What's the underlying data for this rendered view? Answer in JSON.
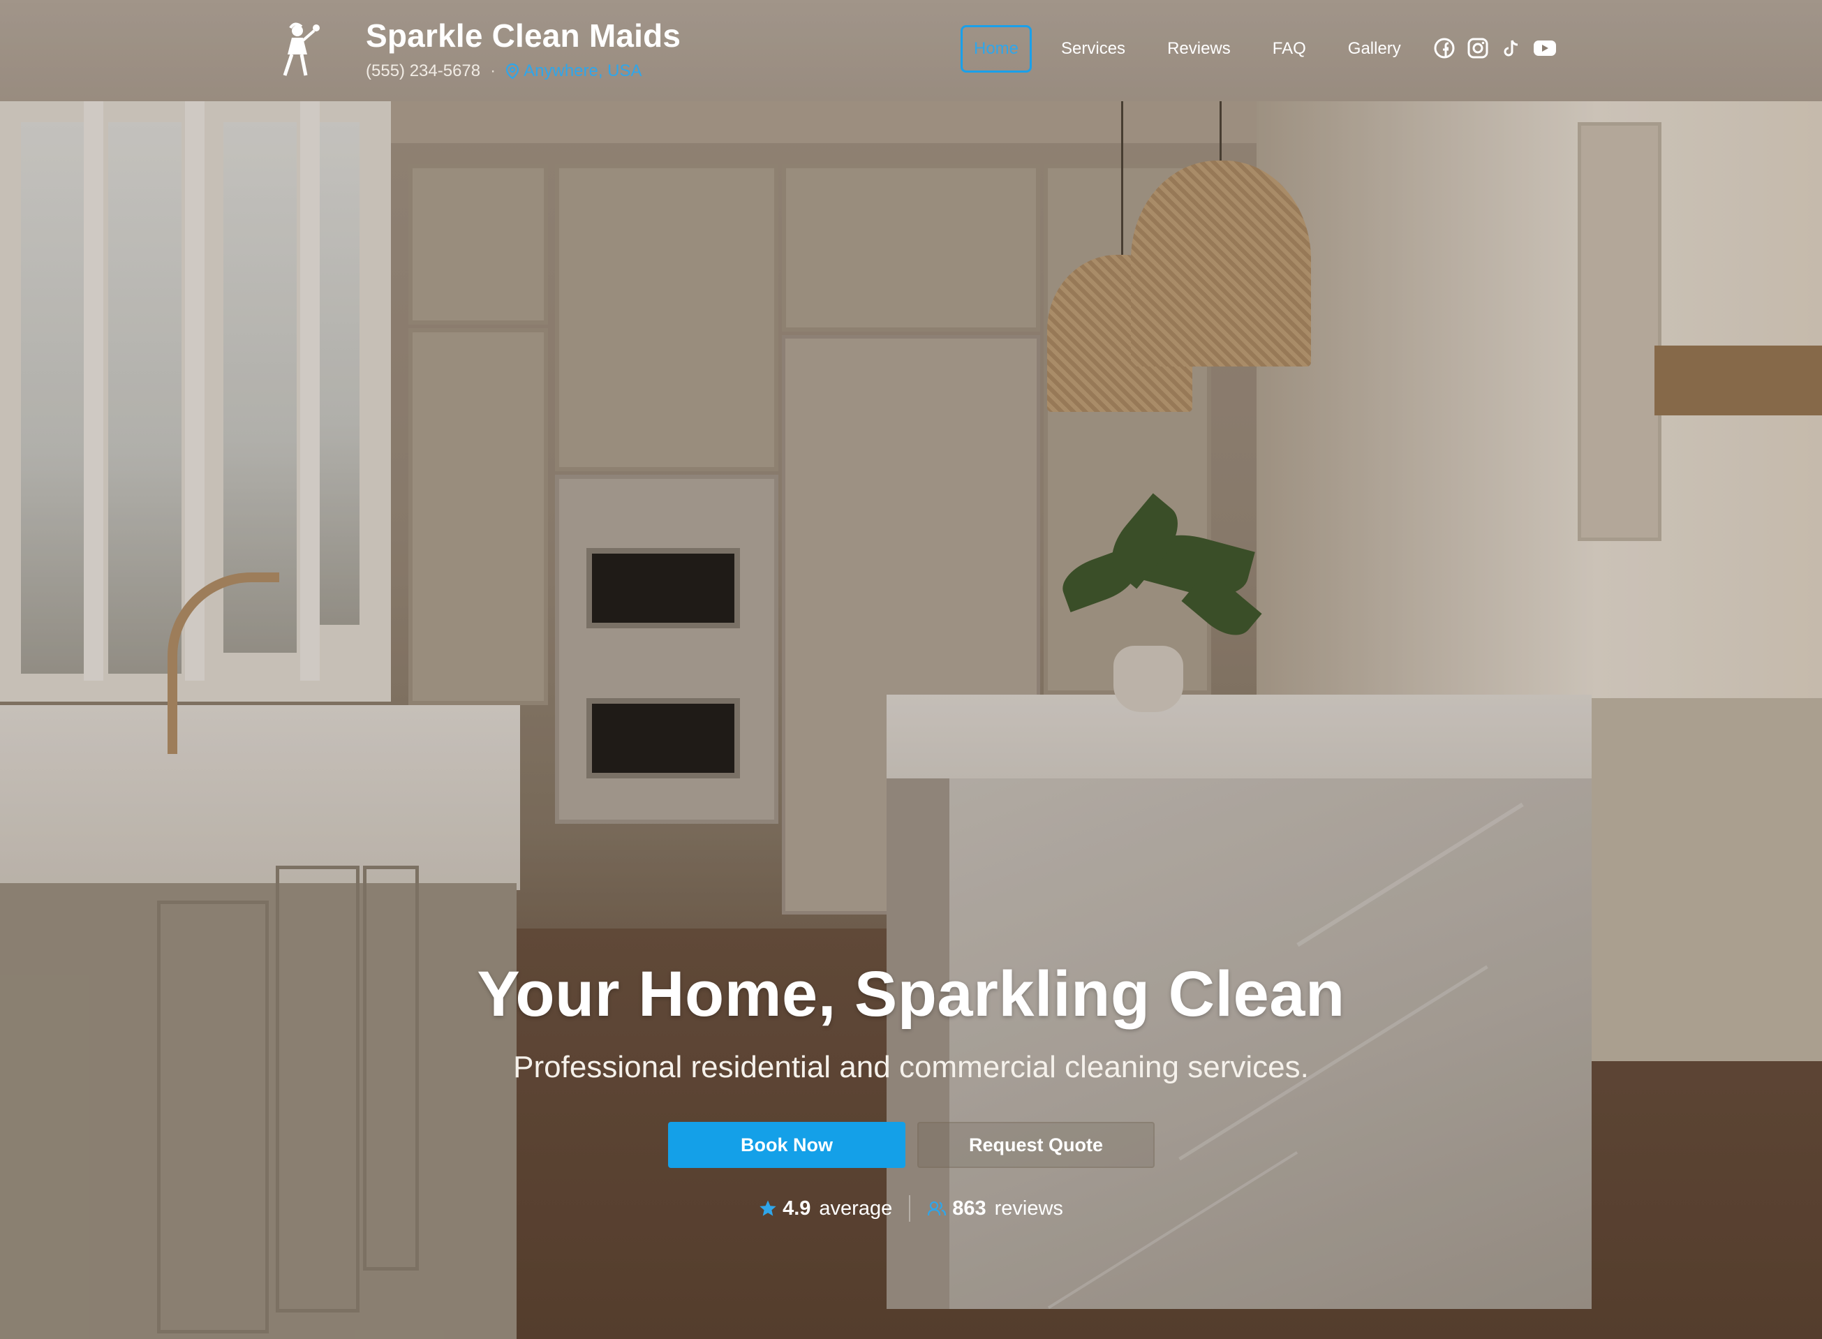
{
  "brand": {
    "name": "Sparkle Clean Maids",
    "phone": "(555) 234-5678",
    "separator": "·",
    "location": "Anywhere, USA"
  },
  "nav": {
    "items": [
      {
        "label": "Home",
        "active": true
      },
      {
        "label": "Services"
      },
      {
        "label": "Reviews"
      },
      {
        "label": "FAQ"
      },
      {
        "label": "Gallery"
      }
    ]
  },
  "social": [
    "facebook-icon",
    "instagram-icon",
    "tiktok-icon",
    "youtube-icon"
  ],
  "hero": {
    "title": "Your Home, Sparkling Clean",
    "subtitle": "Professional residential and commercial cleaning services.",
    "primary_cta": "Book Now",
    "secondary_cta": "Request Quote"
  },
  "stats": {
    "rating_value": "4.9",
    "rating_label": "average",
    "reviews_value": "863",
    "reviews_label": "reviews"
  },
  "colors": {
    "accent": "#14a0e8",
    "link": "#2fa6ea"
  }
}
